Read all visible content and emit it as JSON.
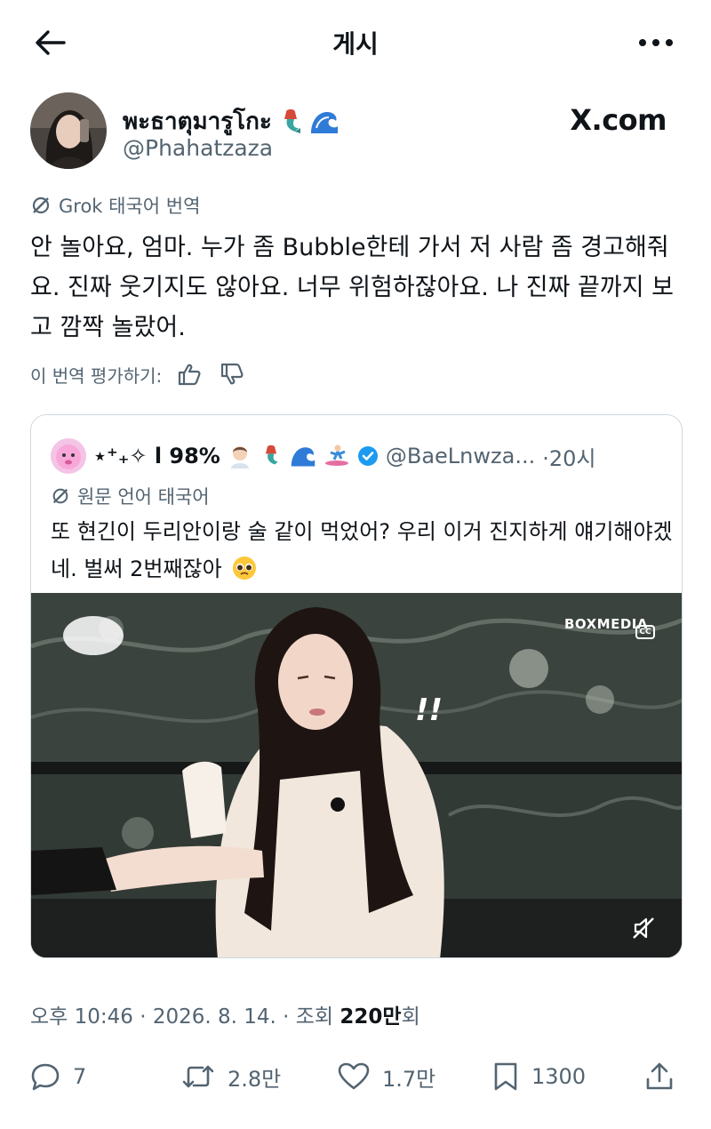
{
  "header": {
    "title": "게시"
  },
  "author": {
    "display_name": "พะธาตุมารูโกะ",
    "name_emoji": [
      "mermaid-emoji",
      "wave-emoji"
    ],
    "handle": "@Phahatzaza",
    "site_label": "X.com"
  },
  "tweet": {
    "translation_label": "Grok 태국어 번역",
    "text": "안 놀아요, 엄마. 누가 좀 Bubble한테 가서 저 사람 좀 경고해줘요. 진짜 웃기지도 않아요. 너무 위험하잖아요. 나 진짜 끝까지 보고 깜짝 놀랐어.",
    "rate_label": "이 번역 평가하기:"
  },
  "quote": {
    "name": "⋆⁺₊✧ l 98%",
    "handle": "@BaeLnwza...",
    "time": "·20시",
    "translation_label": "원문 언어 태국어",
    "text": "또 현긴이 두리안이랑 술 같이 먹었어? 우리 이거 진지하게 얘기해야겠네. 벌써 2번째잖아",
    "media": {
      "brand": "BOXMEDIA",
      "cc_label": "CC",
      "overlay_text": "!!"
    }
  },
  "meta": {
    "prefix": "오후 10:46 · 2026. 8. 14. · 조회 ",
    "views": "220만",
    "suffix": "회"
  },
  "actions": {
    "replies": "7",
    "reposts": "2.8만",
    "likes": "1.7만",
    "bookmarks": "1300"
  },
  "colors": {
    "text": "#0f1419",
    "secondary": "#536471",
    "border": "#cfd9de",
    "verified": "#1d9bf0"
  }
}
